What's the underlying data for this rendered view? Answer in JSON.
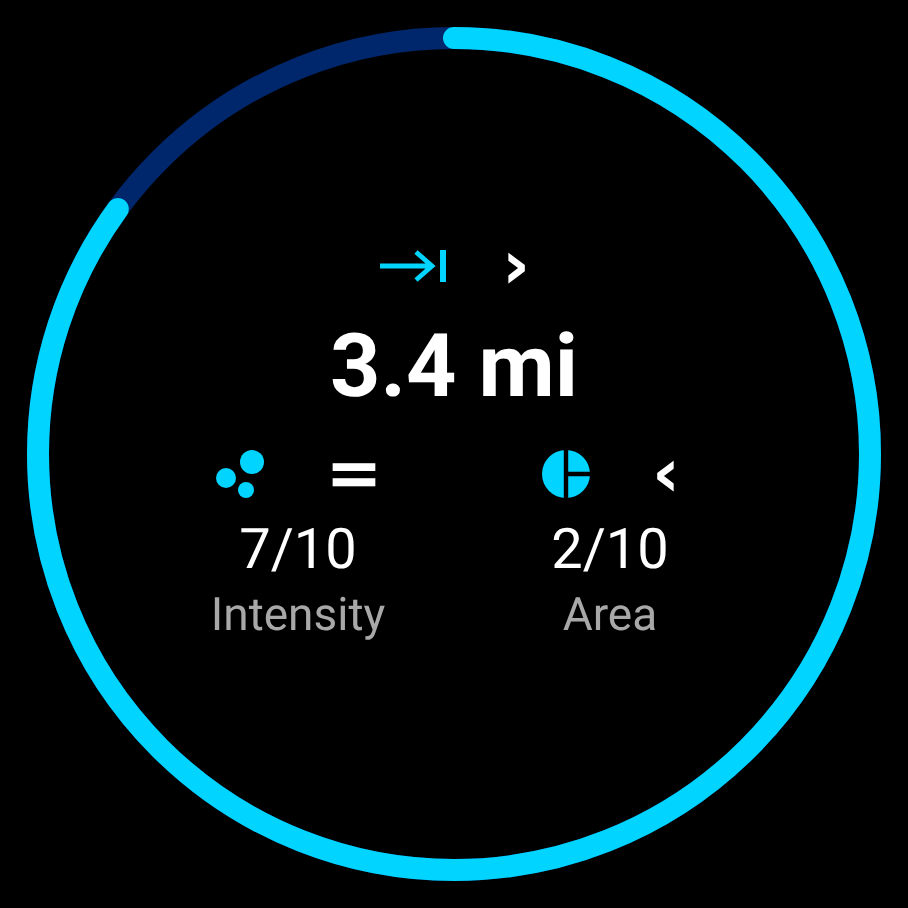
{
  "header": {
    "trend": "›"
  },
  "distance": "3.4 mi",
  "stats": [
    {
      "kind": "intensity",
      "trend": "=",
      "value": "7/10",
      "label": "Intensity"
    },
    {
      "kind": "area",
      "trend": "‹",
      "value": "2/10",
      "label": "Area"
    }
  ]
}
